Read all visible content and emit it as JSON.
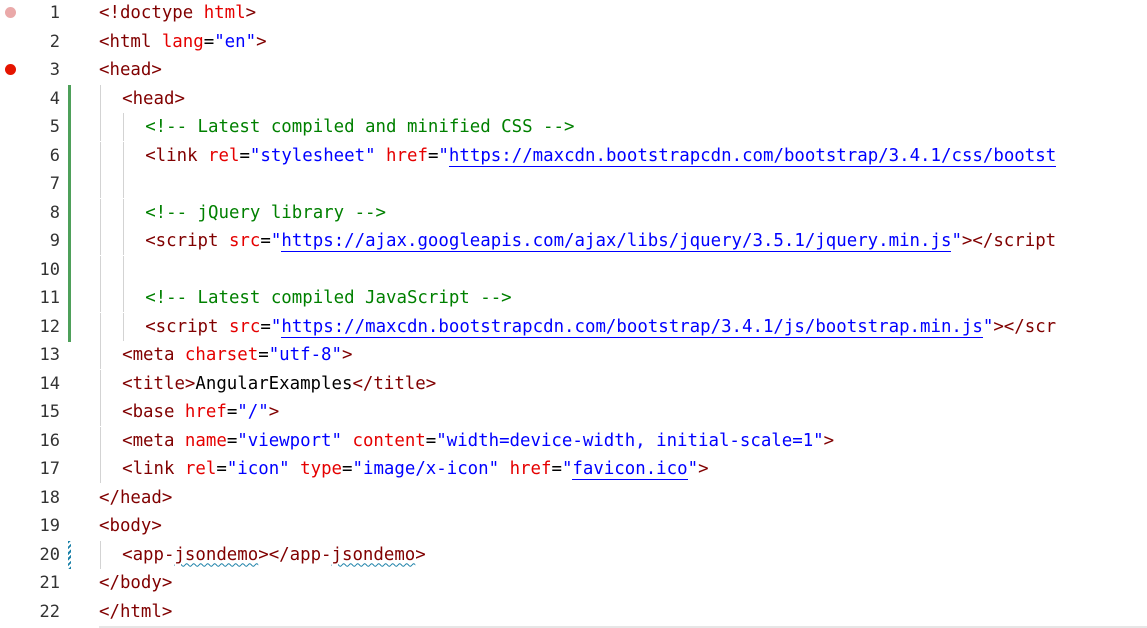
{
  "editor": {
    "breakpoints": {
      "line_1": "faded",
      "line_3": "active"
    },
    "lines": [
      {
        "n": "1",
        "tokens": [
          [
            "tag",
            "<!doctype "
          ],
          [
            "attr",
            "html"
          ],
          [
            "tag",
            ">"
          ]
        ]
      },
      {
        "n": "2",
        "tokens": [
          [
            "tag",
            "<html "
          ],
          [
            "attr",
            "lang"
          ],
          [
            "txt",
            "="
          ],
          [
            "str",
            "\"en\""
          ],
          [
            "tag",
            ">"
          ]
        ]
      },
      {
        "n": "3",
        "tokens": [
          [
            "tag",
            "<head>"
          ]
        ]
      },
      {
        "n": "4",
        "tokens": [
          [
            "tag",
            "<head>"
          ]
        ]
      },
      {
        "n": "5",
        "tokens": [
          [
            "com",
            "<!-- Latest compiled and minified CSS -->"
          ]
        ]
      },
      {
        "n": "6",
        "tokens": [
          [
            "tag",
            "<link "
          ],
          [
            "attr",
            "rel"
          ],
          [
            "txt",
            "="
          ],
          [
            "str",
            "\"stylesheet\" "
          ],
          [
            "attr",
            "href"
          ],
          [
            "txt",
            "="
          ],
          [
            "str",
            "\""
          ],
          [
            "link",
            "https://maxcdn.bootstrapcdn.com/bootstrap/3.4.1/css/bootst"
          ]
        ]
      },
      {
        "n": "7",
        "tokens": []
      },
      {
        "n": "8",
        "tokens": [
          [
            "com",
            "<!-- jQuery library -->"
          ]
        ]
      },
      {
        "n": "9",
        "tokens": [
          [
            "tag",
            "<script "
          ],
          [
            "attr",
            "src"
          ],
          [
            "txt",
            "="
          ],
          [
            "str",
            "\""
          ],
          [
            "link",
            "https://ajax.googleapis.com/ajax/libs/jquery/3.5.1/jquery.min.js"
          ],
          [
            "str",
            "\""
          ],
          [
            "tag",
            "></script"
          ]
        ]
      },
      {
        "n": "10",
        "tokens": []
      },
      {
        "n": "11",
        "tokens": [
          [
            "com",
            "<!-- Latest compiled JavaScript -->"
          ]
        ]
      },
      {
        "n": "12",
        "tokens": [
          [
            "tag",
            "<script "
          ],
          [
            "attr",
            "src"
          ],
          [
            "txt",
            "="
          ],
          [
            "str",
            "\""
          ],
          [
            "link",
            "https://maxcdn.bootstrapcdn.com/bootstrap/3.4.1/js/bootstrap.min.js"
          ],
          [
            "str",
            "\""
          ],
          [
            "tag",
            "></scr"
          ]
        ]
      },
      {
        "n": "13",
        "tokens": [
          [
            "tag",
            "<meta "
          ],
          [
            "attr",
            "charset"
          ],
          [
            "txt",
            "="
          ],
          [
            "str",
            "\"utf-8\""
          ],
          [
            "tag",
            ">"
          ]
        ]
      },
      {
        "n": "14",
        "tokens": [
          [
            "tag",
            "<title>"
          ],
          [
            "txt",
            "AngularExamples"
          ],
          [
            "tag",
            "</title>"
          ]
        ]
      },
      {
        "n": "15",
        "tokens": [
          [
            "tag",
            "<base "
          ],
          [
            "attr",
            "href"
          ],
          [
            "txt",
            "="
          ],
          [
            "str",
            "\"/\""
          ],
          [
            "tag",
            ">"
          ]
        ]
      },
      {
        "n": "16",
        "tokens": [
          [
            "tag",
            "<meta "
          ],
          [
            "attr",
            "name"
          ],
          [
            "txt",
            "="
          ],
          [
            "str",
            "\"viewport\" "
          ],
          [
            "attr",
            "content"
          ],
          [
            "txt",
            "="
          ],
          [
            "str",
            "\"width=device-width, initial-scale=1\""
          ],
          [
            "tag",
            ">"
          ]
        ]
      },
      {
        "n": "17",
        "tokens": [
          [
            "tag",
            "<link "
          ],
          [
            "attr",
            "rel"
          ],
          [
            "txt",
            "="
          ],
          [
            "str",
            "\"icon\" "
          ],
          [
            "attr",
            "type"
          ],
          [
            "txt",
            "="
          ],
          [
            "str",
            "\"image/x-icon\" "
          ],
          [
            "attr",
            "href"
          ],
          [
            "txt",
            "="
          ],
          [
            "str",
            "\""
          ],
          [
            "link",
            "favicon.ico"
          ],
          [
            "str",
            "\""
          ],
          [
            "tag",
            ">"
          ]
        ]
      },
      {
        "n": "18",
        "tokens": [
          [
            "tag",
            "</head>"
          ]
        ]
      },
      {
        "n": "19",
        "tokens": [
          [
            "tag",
            "<body>"
          ]
        ]
      },
      {
        "n": "20",
        "tokens": [
          [
            "tag",
            "<app-"
          ],
          [
            "squig",
            "jsondemo"
          ],
          [
            "tag",
            "></app-"
          ],
          [
            "squig",
            "jsondemo"
          ],
          [
            "tag",
            ">"
          ]
        ]
      },
      {
        "n": "21",
        "tokens": [
          [
            "tag",
            "</body>"
          ]
        ]
      },
      {
        "n": "22",
        "tokens": [
          [
            "tag",
            "</html>"
          ]
        ]
      }
    ]
  }
}
